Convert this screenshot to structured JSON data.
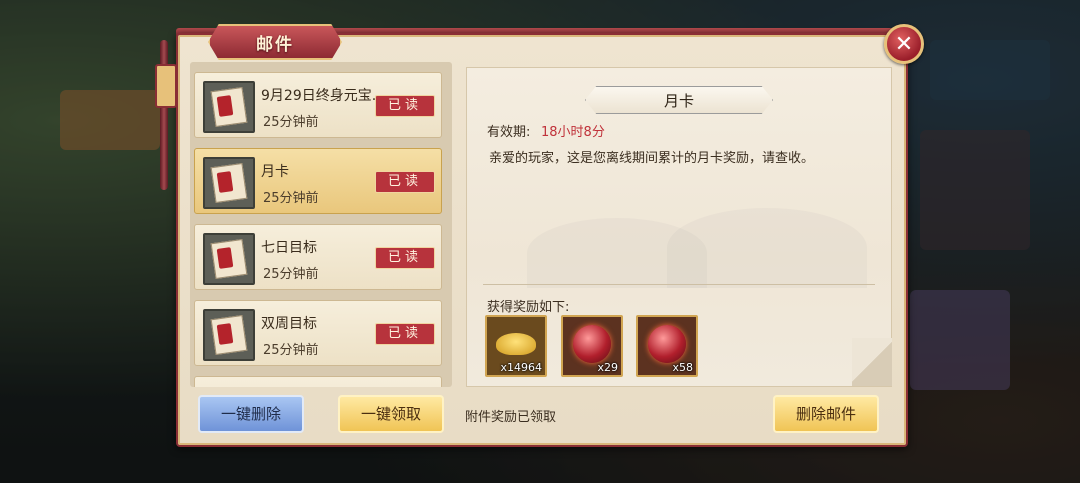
{
  "window": {
    "title": "邮件",
    "close_icon": "close-icon"
  },
  "mail_list": [
    {
      "title": "9月29日终身元宝..",
      "time": "25分钟前",
      "status": "已读",
      "selected": false
    },
    {
      "title": "月卡",
      "time": "25分钟前",
      "status": "已读",
      "selected": true
    },
    {
      "title": "七日目标",
      "time": "25分钟前",
      "status": "已读",
      "selected": false
    },
    {
      "title": "双周目标",
      "time": "25分钟前",
      "status": "已读",
      "selected": false
    }
  ],
  "list_actions": {
    "delete_all": "一键删除",
    "claim_all": "一键领取"
  },
  "detail": {
    "subject": "月卡",
    "validity_label": "有效期:",
    "validity_value": "18小时8分",
    "body": "亲爱的玩家，这是您离线期间累计的月卡奖励，请查收。",
    "rewards_title": "获得奖励如下:",
    "rewards": [
      {
        "icon": "gold-ingot-icon",
        "qty": "x14964"
      },
      {
        "icon": "red-orb-icon",
        "qty": "x29"
      },
      {
        "icon": "red-orb-icon",
        "qty": "x58"
      }
    ],
    "attachment_status": "附件奖励已领取",
    "delete_button": "删除邮件"
  },
  "colors": {
    "accent": "#8a2e35",
    "gold": "#e7c17a",
    "highlight": "#c0323a"
  }
}
